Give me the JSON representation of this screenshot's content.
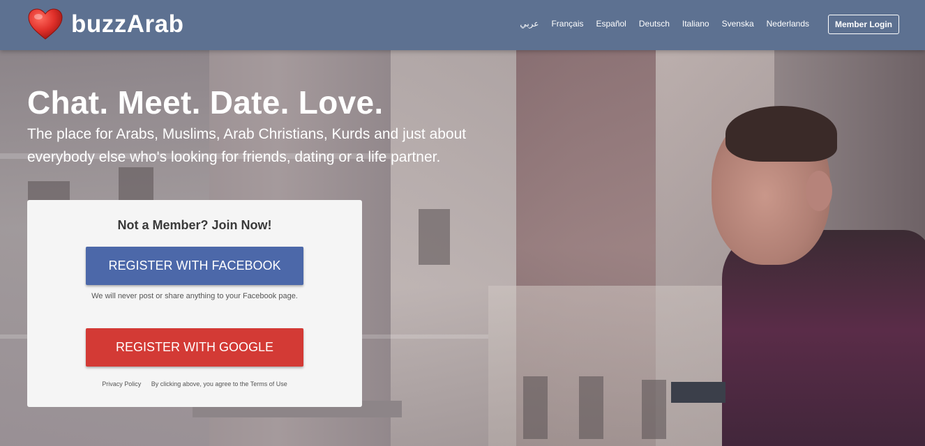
{
  "brand": {
    "name": "buzzArab",
    "heart_color": "#e0302a"
  },
  "nav": {
    "languages": [
      "عربي",
      "Français",
      "Español",
      "Deutsch",
      "Italiano",
      "Svenska",
      "Nederlands"
    ],
    "login_label": "Member Login"
  },
  "hero": {
    "headline": "Chat. Meet. Date. Love.",
    "subline": "The place for Arabs, Muslims, Arab Christians, Kurds and just about everybody else who's looking for friends, dating or a life partner."
  },
  "signup": {
    "title": "Not a Member? Join Now!",
    "facebook_label": "REGISTER WITH FACEBOOK",
    "facebook_note": "We will never post or share anything to your Facebook page.",
    "google_label": "REGISTER WITH GOOGLE",
    "privacy_label": "Privacy Policy",
    "terms_notice": "By clicking above, you agree to the Terms of Use"
  },
  "colors": {
    "header_bg": "#5d7191",
    "facebook": "#4c68a9",
    "google": "#d33a35"
  }
}
